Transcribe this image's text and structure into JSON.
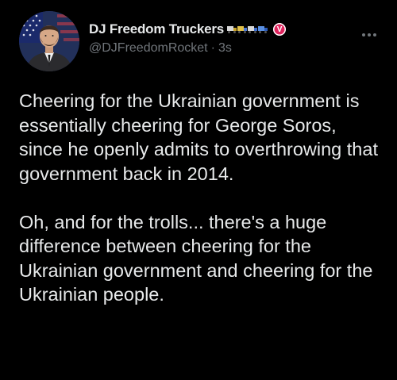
{
  "tweet": {
    "author": {
      "display_name": "DJ Freedom Truckers",
      "name_emojis": [
        "truck-icon",
        "truck-icon",
        "truck-icon",
        "truck-icon"
      ],
      "badge_letter": "V",
      "badge_color": "#e0245e",
      "handle": "@DJFreedomRocket",
      "separator": "·",
      "time": "3s"
    },
    "more_icon": "more-horizontal-icon",
    "paragraphs": [
      "Cheering for the Ukrainian government is essentially cheering for George Soros, since he openly admits to overthrowing that government back in 2014.",
      "Oh, and for the trolls... there's a huge difference between cheering for the Ukrainian government and cheering for the Ukrainian people."
    ]
  },
  "colors": {
    "background": "#000000",
    "text_primary": "#e7e9ea",
    "text_secondary": "#71767b"
  }
}
